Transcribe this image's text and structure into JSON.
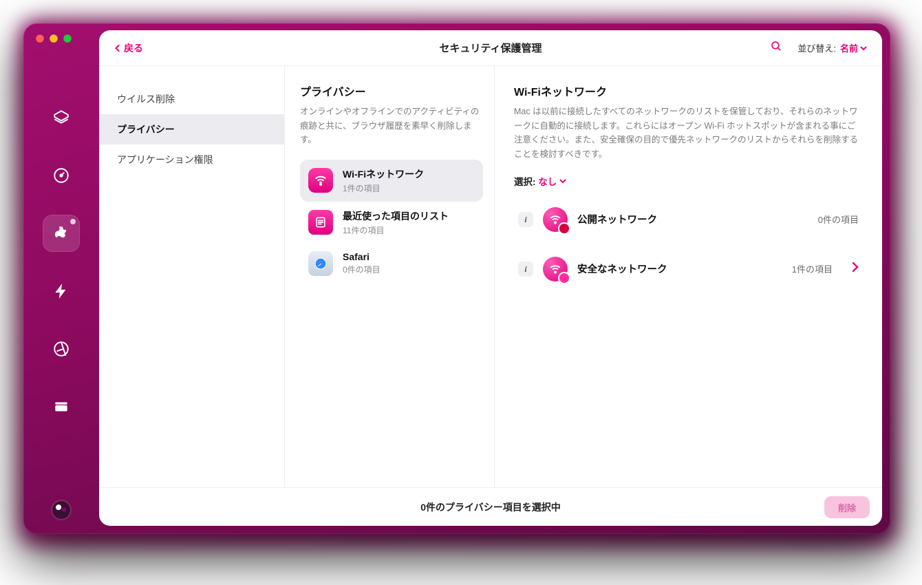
{
  "header": {
    "back_label": "戻る",
    "title": "セキュリティ保護管理",
    "sort_label": "並び替え:",
    "sort_value": "名前"
  },
  "rail": {
    "icons": [
      "scanner",
      "gauge",
      "hand",
      "bolt",
      "compass",
      "drive"
    ]
  },
  "col1": {
    "items": [
      {
        "label": "ウイルス削除",
        "active": false
      },
      {
        "label": "プライバシー",
        "active": true
      },
      {
        "label": "アプリケーション権限",
        "active": false
      }
    ]
  },
  "col2": {
    "heading": "プライバシー",
    "desc": "オンラインやオフラインでのアクティビティの痕跡と共に、ブラウザ履歴を素早く削除します。",
    "modules": [
      {
        "title": "Wi-Fiネットワーク",
        "sub": "1件の項目",
        "icon": "wifi",
        "active": true
      },
      {
        "title": "最近使った項目のリスト",
        "sub": "11件の項目",
        "icon": "list",
        "active": false
      },
      {
        "title": "Safari",
        "sub": "0件の項目",
        "icon": "safari",
        "active": false
      }
    ]
  },
  "col3": {
    "heading": "Wi-Fiネットワーク",
    "desc": "Mac は以前に接続したすべてのネットワークのリストを保管しており、それらのネットワークに自動的に接続します。これらにはオープン Wi-Fi ホットスポットが含まれる事にご注意ください。また、安全確保の目的で優先ネットワークのリストからそれらを削除することを検討すべきです。",
    "select_label": "選択:",
    "select_value": "なし",
    "rows": [
      {
        "name": "公開ネットワーク",
        "count": "0件の項目",
        "kind": "pub",
        "chevron": false
      },
      {
        "name": "安全なネットワーク",
        "count": "1件の項目",
        "kind": "sec",
        "chevron": true
      }
    ]
  },
  "footer": {
    "status": "0件のプライバシー項目を選択中",
    "delete_label": "削除"
  }
}
